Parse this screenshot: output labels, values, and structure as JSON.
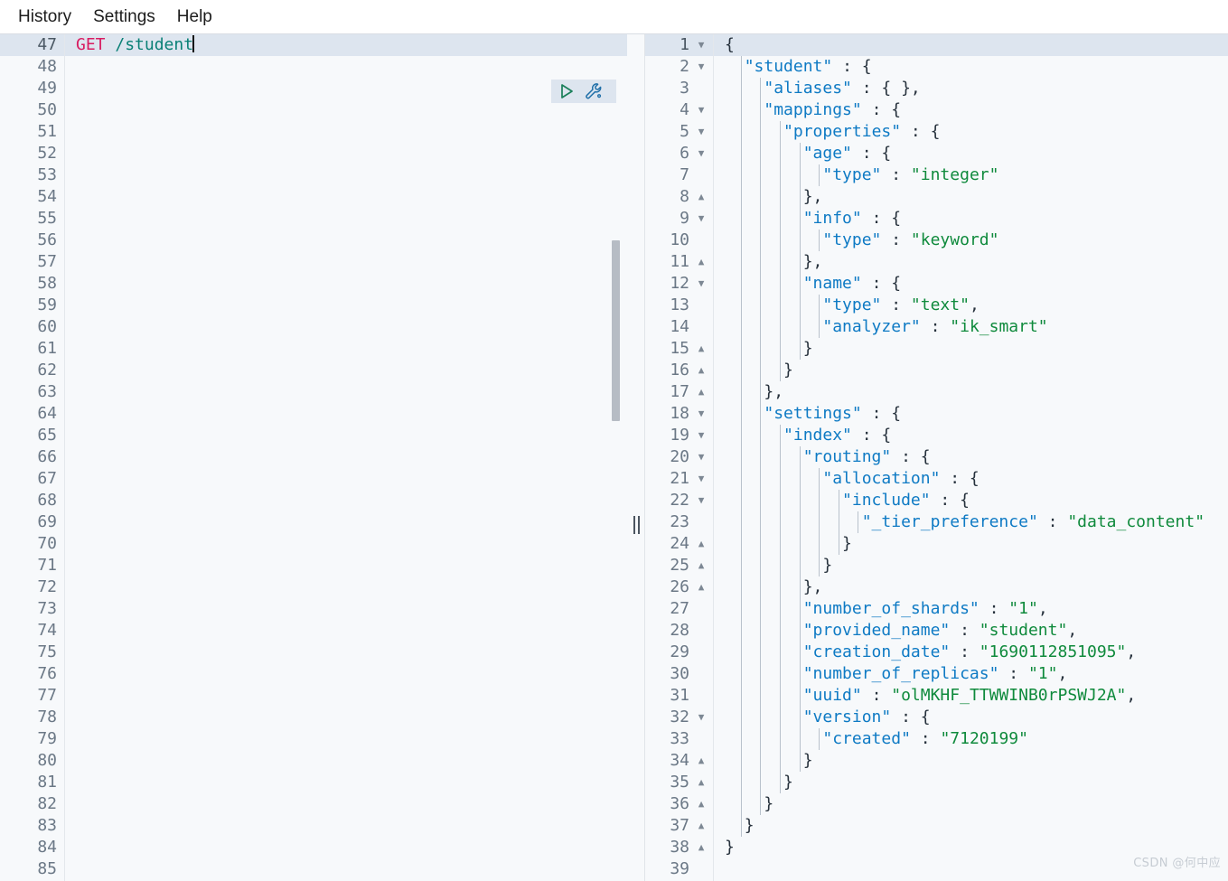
{
  "menubar": {
    "items": [
      {
        "label": "History"
      },
      {
        "label": "Settings"
      },
      {
        "label": "Help"
      }
    ]
  },
  "colors": {
    "key": "#0e7ac4",
    "string": "#0f8a3c",
    "punctuation": "#26313c",
    "http_method": "#d81b60",
    "http_path": "#0a8076",
    "active_line": "#dde5ef",
    "editor_bg": "#f7f9fb",
    "gutter_text": "#6b7886",
    "scrollbar": "#b6bcc4"
  },
  "request_editor": {
    "name": "request-console",
    "first_line_number": 47,
    "last_line_number": 85,
    "active_line_number": 47,
    "lines": [
      {
        "num": 47,
        "tokens": [
          {
            "t": "method",
            "v": "GET"
          },
          {
            "t": "plain",
            "v": " "
          },
          {
            "t": "path",
            "v": "/student"
          }
        ],
        "caret": true
      },
      {
        "num": 48,
        "tokens": []
      },
      {
        "num": 49,
        "tokens": []
      },
      {
        "num": 50,
        "tokens": []
      },
      {
        "num": 51,
        "tokens": []
      },
      {
        "num": 52,
        "tokens": []
      },
      {
        "num": 53,
        "tokens": []
      },
      {
        "num": 54,
        "tokens": []
      },
      {
        "num": 55,
        "tokens": []
      },
      {
        "num": 56,
        "tokens": []
      },
      {
        "num": 57,
        "tokens": []
      },
      {
        "num": 58,
        "tokens": []
      },
      {
        "num": 59,
        "tokens": []
      },
      {
        "num": 60,
        "tokens": []
      },
      {
        "num": 61,
        "tokens": []
      },
      {
        "num": 62,
        "tokens": []
      },
      {
        "num": 63,
        "tokens": []
      },
      {
        "num": 64,
        "tokens": []
      },
      {
        "num": 65,
        "tokens": []
      },
      {
        "num": 66,
        "tokens": []
      },
      {
        "num": 67,
        "tokens": []
      },
      {
        "num": 68,
        "tokens": []
      },
      {
        "num": 69,
        "tokens": []
      },
      {
        "num": 70,
        "tokens": []
      },
      {
        "num": 71,
        "tokens": []
      },
      {
        "num": 72,
        "tokens": []
      },
      {
        "num": 73,
        "tokens": []
      },
      {
        "num": 74,
        "tokens": []
      },
      {
        "num": 75,
        "tokens": []
      },
      {
        "num": 76,
        "tokens": []
      },
      {
        "num": 77,
        "tokens": []
      },
      {
        "num": 78,
        "tokens": []
      },
      {
        "num": 79,
        "tokens": []
      },
      {
        "num": 80,
        "tokens": []
      },
      {
        "num": 81,
        "tokens": []
      },
      {
        "num": 82,
        "tokens": []
      },
      {
        "num": 83,
        "tokens": []
      },
      {
        "num": 84,
        "tokens": []
      },
      {
        "num": 85,
        "tokens": []
      }
    ],
    "actions": [
      {
        "name": "run-request-icon",
        "label": "Run"
      },
      {
        "name": "wrench-tools-icon",
        "label": "Tools"
      }
    ]
  },
  "response_editor": {
    "name": "response-console",
    "first_line_number": 1,
    "last_line_number": 39,
    "active_line_number": 1,
    "lines": [
      {
        "num": 1,
        "fold": "open",
        "indent": 0,
        "tokens": [
          {
            "t": "punc",
            "v": "{"
          }
        ]
      },
      {
        "num": 2,
        "fold": "open",
        "indent": 1,
        "tokens": [
          {
            "t": "key",
            "v": "\"student\""
          },
          {
            "t": "punc",
            "v": " : {"
          }
        ]
      },
      {
        "num": 3,
        "fold": "none",
        "indent": 2,
        "tokens": [
          {
            "t": "key",
            "v": "\"aliases\""
          },
          {
            "t": "punc",
            "v": " : { },"
          }
        ]
      },
      {
        "num": 4,
        "fold": "open",
        "indent": 2,
        "tokens": [
          {
            "t": "key",
            "v": "\"mappings\""
          },
          {
            "t": "punc",
            "v": " : {"
          }
        ]
      },
      {
        "num": 5,
        "fold": "open",
        "indent": 3,
        "tokens": [
          {
            "t": "key",
            "v": "\"properties\""
          },
          {
            "t": "punc",
            "v": " : {"
          }
        ]
      },
      {
        "num": 6,
        "fold": "open",
        "indent": 4,
        "tokens": [
          {
            "t": "key",
            "v": "\"age\""
          },
          {
            "t": "punc",
            "v": " : {"
          }
        ]
      },
      {
        "num": 7,
        "fold": "none",
        "indent": 5,
        "tokens": [
          {
            "t": "key",
            "v": "\"type\""
          },
          {
            "t": "punc",
            "v": " : "
          },
          {
            "t": "str",
            "v": "\"integer\""
          }
        ]
      },
      {
        "num": 8,
        "fold": "close",
        "indent": 4,
        "tokens": [
          {
            "t": "punc",
            "v": "},"
          }
        ]
      },
      {
        "num": 9,
        "fold": "open",
        "indent": 4,
        "tokens": [
          {
            "t": "key",
            "v": "\"info\""
          },
          {
            "t": "punc",
            "v": " : {"
          }
        ]
      },
      {
        "num": 10,
        "fold": "none",
        "indent": 5,
        "tokens": [
          {
            "t": "key",
            "v": "\"type\""
          },
          {
            "t": "punc",
            "v": " : "
          },
          {
            "t": "str",
            "v": "\"keyword\""
          }
        ]
      },
      {
        "num": 11,
        "fold": "close",
        "indent": 4,
        "tokens": [
          {
            "t": "punc",
            "v": "},"
          }
        ]
      },
      {
        "num": 12,
        "fold": "open",
        "indent": 4,
        "tokens": [
          {
            "t": "key",
            "v": "\"name\""
          },
          {
            "t": "punc",
            "v": " : {"
          }
        ]
      },
      {
        "num": 13,
        "fold": "none",
        "indent": 5,
        "tokens": [
          {
            "t": "key",
            "v": "\"type\""
          },
          {
            "t": "punc",
            "v": " : "
          },
          {
            "t": "str",
            "v": "\"text\""
          },
          {
            "t": "punc",
            "v": ","
          }
        ]
      },
      {
        "num": 14,
        "fold": "none",
        "indent": 5,
        "tokens": [
          {
            "t": "key",
            "v": "\"analyzer\""
          },
          {
            "t": "punc",
            "v": " : "
          },
          {
            "t": "str",
            "v": "\"ik_smart\""
          }
        ]
      },
      {
        "num": 15,
        "fold": "close",
        "indent": 4,
        "tokens": [
          {
            "t": "punc",
            "v": "}"
          }
        ]
      },
      {
        "num": 16,
        "fold": "close",
        "indent": 3,
        "tokens": [
          {
            "t": "punc",
            "v": "}"
          }
        ]
      },
      {
        "num": 17,
        "fold": "close",
        "indent": 2,
        "tokens": [
          {
            "t": "punc",
            "v": "},"
          }
        ]
      },
      {
        "num": 18,
        "fold": "open",
        "indent": 2,
        "tokens": [
          {
            "t": "key",
            "v": "\"settings\""
          },
          {
            "t": "punc",
            "v": " : {"
          }
        ]
      },
      {
        "num": 19,
        "fold": "open",
        "indent": 3,
        "tokens": [
          {
            "t": "key",
            "v": "\"index\""
          },
          {
            "t": "punc",
            "v": " : {"
          }
        ]
      },
      {
        "num": 20,
        "fold": "open",
        "indent": 4,
        "tokens": [
          {
            "t": "key",
            "v": "\"routing\""
          },
          {
            "t": "punc",
            "v": " : {"
          }
        ]
      },
      {
        "num": 21,
        "fold": "open",
        "indent": 5,
        "tokens": [
          {
            "t": "key",
            "v": "\"allocation\""
          },
          {
            "t": "punc",
            "v": " : {"
          }
        ]
      },
      {
        "num": 22,
        "fold": "open",
        "indent": 6,
        "tokens": [
          {
            "t": "key",
            "v": "\"include\""
          },
          {
            "t": "punc",
            "v": " : {"
          }
        ]
      },
      {
        "num": 23,
        "fold": "none",
        "indent": 7,
        "tokens": [
          {
            "t": "key",
            "v": "\"_tier_preference\""
          },
          {
            "t": "punc",
            "v": " : "
          },
          {
            "t": "str",
            "v": "\"data_content\""
          }
        ]
      },
      {
        "num": 24,
        "fold": "close",
        "indent": 6,
        "tokens": [
          {
            "t": "punc",
            "v": "}"
          }
        ]
      },
      {
        "num": 25,
        "fold": "close",
        "indent": 5,
        "tokens": [
          {
            "t": "punc",
            "v": "}"
          }
        ]
      },
      {
        "num": 26,
        "fold": "close",
        "indent": 4,
        "tokens": [
          {
            "t": "punc",
            "v": "},"
          }
        ]
      },
      {
        "num": 27,
        "fold": "none",
        "indent": 4,
        "tokens": [
          {
            "t": "key",
            "v": "\"number_of_shards\""
          },
          {
            "t": "punc",
            "v": " : "
          },
          {
            "t": "str",
            "v": "\"1\""
          },
          {
            "t": "punc",
            "v": ","
          }
        ]
      },
      {
        "num": 28,
        "fold": "none",
        "indent": 4,
        "tokens": [
          {
            "t": "key",
            "v": "\"provided_name\""
          },
          {
            "t": "punc",
            "v": " : "
          },
          {
            "t": "str",
            "v": "\"student\""
          },
          {
            "t": "punc",
            "v": ","
          }
        ]
      },
      {
        "num": 29,
        "fold": "none",
        "indent": 4,
        "tokens": [
          {
            "t": "key",
            "v": "\"creation_date\""
          },
          {
            "t": "punc",
            "v": " : "
          },
          {
            "t": "str",
            "v": "\"1690112851095\""
          },
          {
            "t": "punc",
            "v": ","
          }
        ]
      },
      {
        "num": 30,
        "fold": "none",
        "indent": 4,
        "tokens": [
          {
            "t": "key",
            "v": "\"number_of_replicas\""
          },
          {
            "t": "punc",
            "v": " : "
          },
          {
            "t": "str",
            "v": "\"1\""
          },
          {
            "t": "punc",
            "v": ","
          }
        ]
      },
      {
        "num": 31,
        "fold": "none",
        "indent": 4,
        "tokens": [
          {
            "t": "key",
            "v": "\"uuid\""
          },
          {
            "t": "punc",
            "v": " : "
          },
          {
            "t": "str",
            "v": "\"olMKHF_TTWWINB0rPSWJ2A\""
          },
          {
            "t": "punc",
            "v": ","
          }
        ]
      },
      {
        "num": 32,
        "fold": "open",
        "indent": 4,
        "tokens": [
          {
            "t": "key",
            "v": "\"version\""
          },
          {
            "t": "punc",
            "v": " : {"
          }
        ]
      },
      {
        "num": 33,
        "fold": "none",
        "indent": 5,
        "tokens": [
          {
            "t": "key",
            "v": "\"created\""
          },
          {
            "t": "punc",
            "v": " : "
          },
          {
            "t": "str",
            "v": "\"7120199\""
          }
        ]
      },
      {
        "num": 34,
        "fold": "close",
        "indent": 4,
        "tokens": [
          {
            "t": "punc",
            "v": "}"
          }
        ]
      },
      {
        "num": 35,
        "fold": "close",
        "indent": 3,
        "tokens": [
          {
            "t": "punc",
            "v": "}"
          }
        ]
      },
      {
        "num": 36,
        "fold": "close",
        "indent": 2,
        "tokens": [
          {
            "t": "punc",
            "v": "}"
          }
        ]
      },
      {
        "num": 37,
        "fold": "close",
        "indent": 1,
        "tokens": [
          {
            "t": "punc",
            "v": "}"
          }
        ]
      },
      {
        "num": 38,
        "fold": "close",
        "indent": 0,
        "tokens": [
          {
            "t": "punc",
            "v": "}"
          }
        ]
      },
      {
        "num": 39,
        "fold": "none",
        "indent": 0,
        "tokens": []
      }
    ]
  },
  "splitter": {
    "name": "pane-splitter",
    "handle": "||"
  },
  "watermark": {
    "text": "CSDN @何中应"
  }
}
